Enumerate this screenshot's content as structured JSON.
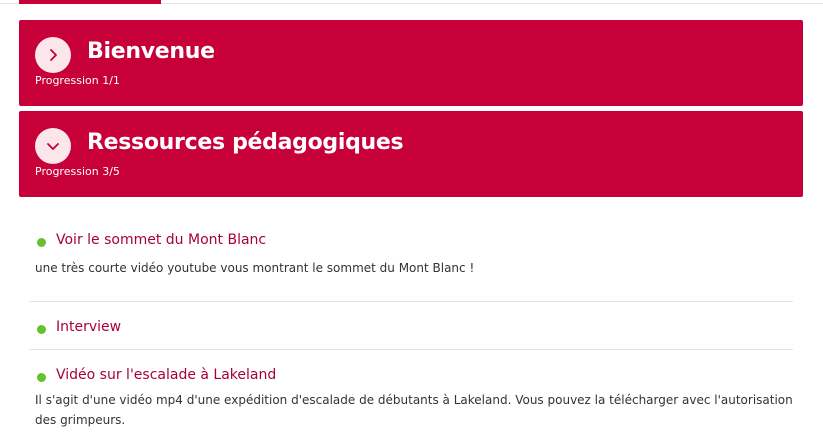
{
  "sections": [
    {
      "title": "Bienvenue",
      "progress": "Progression 1/1",
      "toggle_icon": "chevron-right-icon",
      "expanded": false
    },
    {
      "title": "Ressources pédagogiques",
      "progress": "Progression 3/5",
      "toggle_icon": "chevron-down-icon",
      "expanded": true
    }
  ],
  "activities": [
    {
      "title": "Voir le sommet du Mont Blanc",
      "description": "une très courte vidéo youtube vous montrant le sommet du Mont Blanc !",
      "status_color": "#6abf2f"
    },
    {
      "title": "Interview",
      "description": "",
      "status_color": "#6abf2f"
    },
    {
      "title": "Vidéo sur l'escalade à Lakeland",
      "description": "Il s'agit d'une vidéo mp4 d'une expédition d'escalade de débutants à Lakeland. Vous pouvez la télécharger avec l'autorisation des grimpeurs.",
      "status_color": "#6abf2f"
    }
  ],
  "colors": {
    "accent": "#c8003a",
    "link": "#a8003a",
    "complete": "#6abf2f"
  }
}
